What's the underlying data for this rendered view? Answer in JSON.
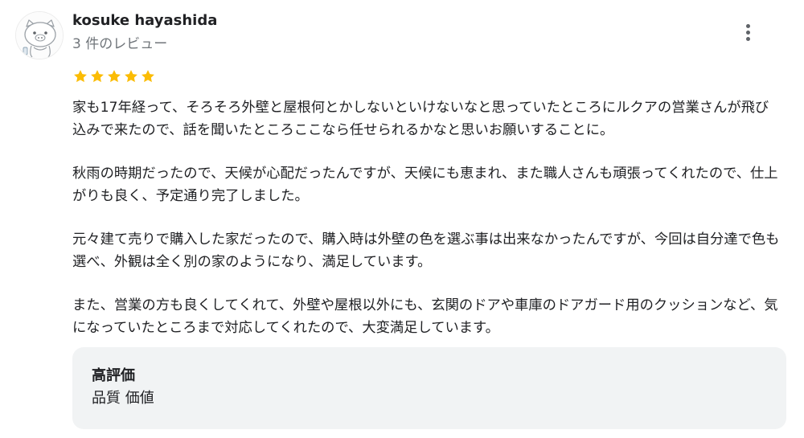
{
  "reviewer": {
    "name": "kosuke hayashida",
    "review_count": "3 件のレビュー"
  },
  "rating": {
    "stars": 5,
    "max": 5,
    "star_color": "#fbbc04"
  },
  "review": {
    "paragraphs": [
      "家も17年経って、そろそろ外壁と屋根何とかしないといけないなと思っていたところにルクアの営業さんが飛び込みで来たので、話を聞いたところここなら任せられるかなと思いお願いすることに。",
      "秋雨の時期だったので、天候が心配だったんですが、天候にも恵まれ、また職人さんも頑張ってくれたので、仕上がりも良く、予定通り完了しました。",
      "元々建て売りで購入した家だったので、購入時は外壁の色を選ぶ事は出来なかったんですが、今回は自分達で色も選べ、外観は全く別の家のようになり、満足しています。",
      "また、営業の方も良くしてくれて、外壁や屋根以外にも、玄関のドアや車庫のドアガード用のクッションなど、気になっていたところまで対応してくれたので、大変満足しています。"
    ]
  },
  "highlights": {
    "title": "高評価",
    "value": "品質 価値"
  },
  "icons": {
    "avatar": "pig-avatar-icon",
    "menu": "more-vert-icon",
    "star": "star-icon"
  },
  "colors": {
    "card_background": "#f1f3f4",
    "secondary_text": "#70757a"
  }
}
